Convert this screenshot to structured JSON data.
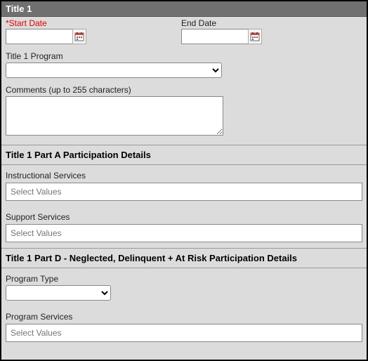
{
  "header": {
    "title": "Title 1"
  },
  "dates": {
    "start_label": "*Start Date",
    "end_label": "End Date",
    "start_value": "",
    "end_value": ""
  },
  "program": {
    "label": "Title 1 Program",
    "value": ""
  },
  "comments": {
    "label": "Comments (up to 255 characters)",
    "value": ""
  },
  "partA": {
    "heading": "Title 1 Part A Participation Details",
    "instructional_label": "Instructional Services",
    "instructional_placeholder": "Select Values",
    "support_label": "Support Services",
    "support_placeholder": "Select Values"
  },
  "partD": {
    "heading": "Title 1 Part D - Neglected, Delinquent + At Risk Participation Details",
    "program_type_label": "Program Type",
    "program_type_value": "",
    "program_services_label": "Program Services",
    "program_services_placeholder": "Select Values"
  }
}
